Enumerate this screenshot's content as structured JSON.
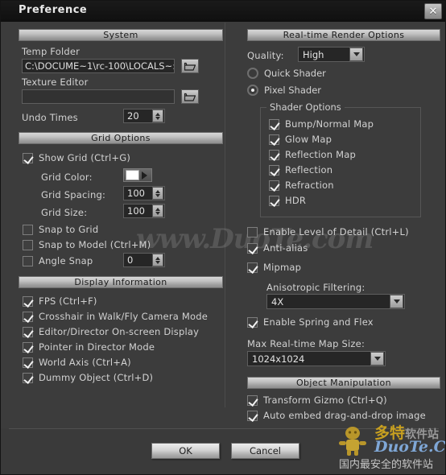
{
  "window": {
    "title": "Preference",
    "close_label": "✕"
  },
  "left": {
    "system": {
      "header": "System",
      "temp_folder_label": "Temp Folder",
      "temp_folder_value": "C:\\DOCUME~1\\rc-100\\LOCALS~:",
      "texture_editor_label": "Texture Editor",
      "texture_editor_value": "",
      "undo_times_label": "Undo Times",
      "undo_times_value": "20",
      "browse_icon": "folder-icon"
    },
    "grid": {
      "header": "Grid Options",
      "show_grid": {
        "label": "Show Grid (Ctrl+G)",
        "checked": true
      },
      "grid_color_label": "Grid Color:",
      "grid_color_value": "#ffffff",
      "grid_spacing_label": "Grid Spacing:",
      "grid_spacing_value": "100",
      "grid_size_label": "Grid Size:",
      "grid_size_value": "100",
      "snap_to_grid": {
        "label": "Snap to Grid",
        "checked": false
      },
      "snap_to_model": {
        "label": "Snap to Model (Ctrl+M)",
        "checked": false
      },
      "angle_snap": {
        "label": "Angle Snap",
        "checked": false
      },
      "angle_snap_value": "0"
    },
    "display": {
      "header": "Display Information",
      "items": [
        {
          "label": "FPS (Ctrl+F)",
          "checked": true
        },
        {
          "label": "Crosshair in Walk/Fly Camera Mode",
          "checked": true
        },
        {
          "label": "Editor/Director On-screen Display",
          "checked": true
        },
        {
          "label": "Pointer in Director Mode",
          "checked": true
        },
        {
          "label": "World Axis (Ctrl+A)",
          "checked": true
        },
        {
          "label": "Dummy Object (Ctrl+D)",
          "checked": true
        }
      ]
    }
  },
  "right": {
    "render": {
      "header": "Real-time Render Options",
      "quality_label": "Quality:",
      "quality_value": "High",
      "quick_shader": {
        "label": "Quick Shader",
        "selected": false
      },
      "pixel_shader": {
        "label": "Pixel Shader",
        "selected": true
      },
      "shader_options": {
        "title": "Shader Options",
        "items": [
          {
            "label": "Bump/Normal Map",
            "checked": true
          },
          {
            "label": "Glow Map",
            "checked": true
          },
          {
            "label": "Reflection Map",
            "checked": true
          },
          {
            "label": "Reflection",
            "checked": true
          },
          {
            "label": "Refraction",
            "checked": true
          },
          {
            "label": "HDR",
            "checked": true
          }
        ]
      },
      "enable_lod": {
        "label": "Enable Level of Detail (Ctrl+L)",
        "checked": false
      },
      "anti_alias": {
        "label": "Anti-alias",
        "checked": true
      },
      "mipmap": {
        "label": "Mipmap",
        "checked": true
      },
      "aniso_label": "Anisotropic Filtering:",
      "aniso_value": "4X",
      "spring_flex": {
        "label": "Enable Spring and Flex",
        "checked": true
      },
      "max_map_label": "Max Real-time Map Size:",
      "max_map_value": "1024x1024"
    },
    "object_manipulation": {
      "header": "Object Manipulation",
      "items": [
        {
          "label": "Transform Gizmo (Ctrl+Q)",
          "checked": true
        },
        {
          "label": "Auto embed drag-and-drop image",
          "checked": true
        }
      ]
    }
  },
  "footer": {
    "ok_label": "OK",
    "cancel_label": "Cancel"
  },
  "watermark": {
    "center_text": "www.DuoTe.com",
    "logo_cn_top": "多特",
    "logo_cn_top_gray": "软件站",
    "logo_domain": "DuoTe.Com",
    "logo_cn_bottom": "国内最安全的软件站"
  }
}
